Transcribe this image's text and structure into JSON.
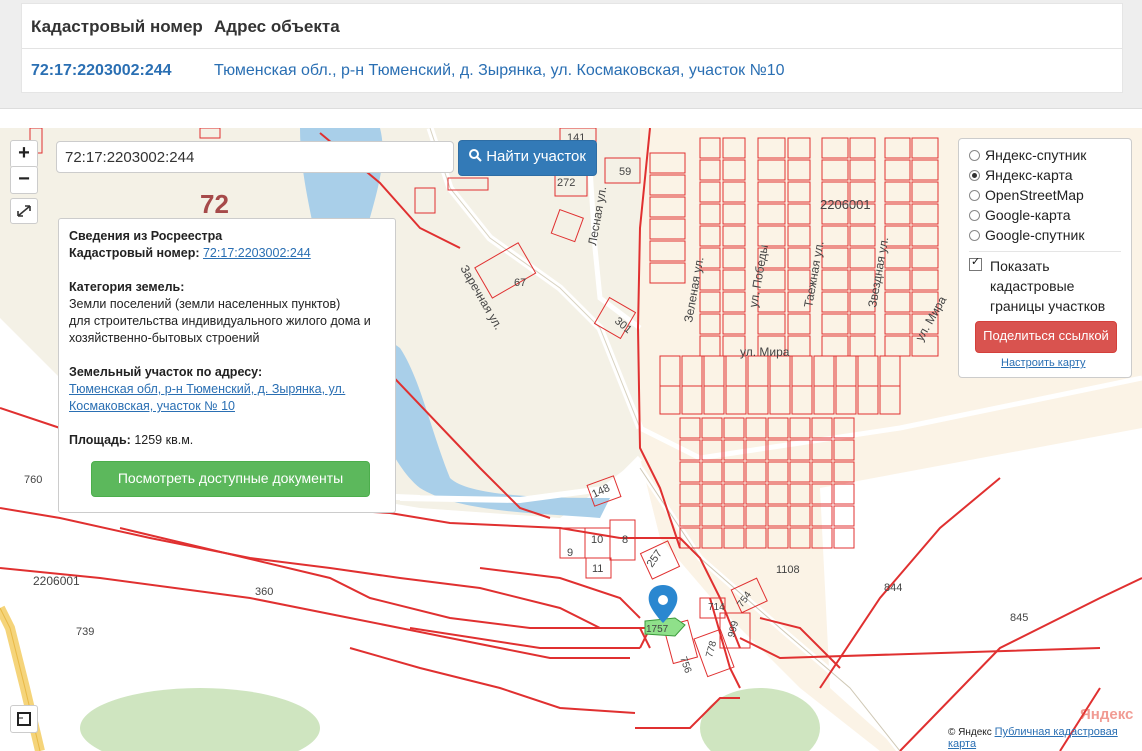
{
  "table": {
    "col_cadastral": "Кадастровый номер",
    "col_address": "Адрес объекта",
    "cadastral_value": "72:17:2203002:244",
    "address_value": "Тюменская обл., р-н Тюменский, д. Зырянка, ул. Космаковская, участок №10"
  },
  "map": {
    "zoom_in": "+",
    "zoom_out": "−",
    "search_value": "72:17:2203002:244",
    "search_button": "Найти участок",
    "region_label": "72",
    "info": {
      "title": "Сведения из Росреестра",
      "cad_label": "Кадастровый номер:",
      "cad_value": "72:17:2203002:244",
      "cat_label": "Категория земель:",
      "cat_line1": "Земли поселений (земли населенных пунктов)",
      "cat_line2": "для строительства индивидуального жилого дома и",
      "cat_line3": "хозяйственно-бытовых строений",
      "addr_label": "Земельный участок по адресу:",
      "addr_line1": "Тюменская обл, р-н Тюменский, д. Зырянка, ул.",
      "addr_line2": "Космаковская, участок № 10",
      "area_label": "Площадь:",
      "area_value": "1259 кв.м.",
      "docs_button": "Посмотреть доступные документы"
    },
    "layers": {
      "opt1": "Яндекс-спутник",
      "opt2": "Яндекс-карта",
      "opt3": "OpenStreetMap",
      "opt4": "Google-карта",
      "opt5": "Google-спутник",
      "selected": "Яндекс-карта",
      "show_borders_1": "Показать",
      "show_borders_2": "кадастровые",
      "show_borders_3": "границы участков",
      "share_button": "Поделиться ссылкой",
      "configure_link": "Настроить карту"
    },
    "labels": {
      "q1": "2206001",
      "q2": "2206001",
      "p67": "67",
      "p59": "59",
      "p141": "141",
      "p272": "272",
      "p301": "301",
      "p148": "148",
      "p257": "257",
      "p760": "760",
      "p739": "739",
      "p360": "360",
      "p844": "844",
      "p845": "845",
      "p1108": "1108",
      "p1757": "1757",
      "p754": "754",
      "p756": "756",
      "p778": "778",
      "p999": "999",
      "p714": "714",
      "p9": "9",
      "p10": "10",
      "p8": "8",
      "p11": "11",
      "street1": "Заречная ул.",
      "street2": "Лесная ул.",
      "street3": "ул. Мира",
      "street4": "ул. Мира",
      "street5": "Таежная ул.",
      "street6": "Звездная ул.",
      "street7": "ул. Победы",
      "street8": "Зеленая ул."
    },
    "attribution_left": "© Яндекс",
    "attribution_link": "Публичная кадастровая карта",
    "yandex_logo": "Яндекс"
  }
}
